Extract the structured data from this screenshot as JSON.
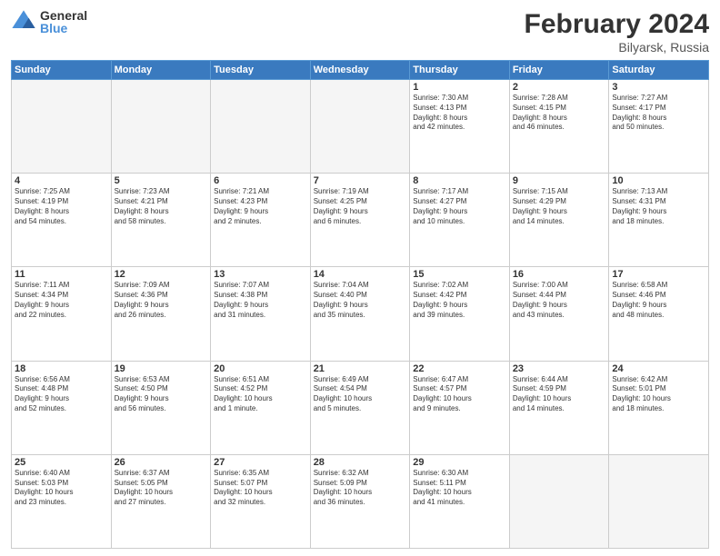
{
  "header": {
    "logo": {
      "general": "General",
      "blue": "Blue"
    },
    "title": "February 2024",
    "location": "Bilyarsk, Russia"
  },
  "calendar": {
    "days_of_week": [
      "Sunday",
      "Monday",
      "Tuesday",
      "Wednesday",
      "Thursday",
      "Friday",
      "Saturday"
    ],
    "weeks": [
      [
        {
          "day": "",
          "info": ""
        },
        {
          "day": "",
          "info": ""
        },
        {
          "day": "",
          "info": ""
        },
        {
          "day": "",
          "info": ""
        },
        {
          "day": "1",
          "info": "Sunrise: 7:30 AM\nSunset: 4:13 PM\nDaylight: 8 hours\nand 42 minutes."
        },
        {
          "day": "2",
          "info": "Sunrise: 7:28 AM\nSunset: 4:15 PM\nDaylight: 8 hours\nand 46 minutes."
        },
        {
          "day": "3",
          "info": "Sunrise: 7:27 AM\nSunset: 4:17 PM\nDaylight: 8 hours\nand 50 minutes."
        }
      ],
      [
        {
          "day": "4",
          "info": "Sunrise: 7:25 AM\nSunset: 4:19 PM\nDaylight: 8 hours\nand 54 minutes."
        },
        {
          "day": "5",
          "info": "Sunrise: 7:23 AM\nSunset: 4:21 PM\nDaylight: 8 hours\nand 58 minutes."
        },
        {
          "day": "6",
          "info": "Sunrise: 7:21 AM\nSunset: 4:23 PM\nDaylight: 9 hours\nand 2 minutes."
        },
        {
          "day": "7",
          "info": "Sunrise: 7:19 AM\nSunset: 4:25 PM\nDaylight: 9 hours\nand 6 minutes."
        },
        {
          "day": "8",
          "info": "Sunrise: 7:17 AM\nSunset: 4:27 PM\nDaylight: 9 hours\nand 10 minutes."
        },
        {
          "day": "9",
          "info": "Sunrise: 7:15 AM\nSunset: 4:29 PM\nDaylight: 9 hours\nand 14 minutes."
        },
        {
          "day": "10",
          "info": "Sunrise: 7:13 AM\nSunset: 4:31 PM\nDaylight: 9 hours\nand 18 minutes."
        }
      ],
      [
        {
          "day": "11",
          "info": "Sunrise: 7:11 AM\nSunset: 4:34 PM\nDaylight: 9 hours\nand 22 minutes."
        },
        {
          "day": "12",
          "info": "Sunrise: 7:09 AM\nSunset: 4:36 PM\nDaylight: 9 hours\nand 26 minutes."
        },
        {
          "day": "13",
          "info": "Sunrise: 7:07 AM\nSunset: 4:38 PM\nDaylight: 9 hours\nand 31 minutes."
        },
        {
          "day": "14",
          "info": "Sunrise: 7:04 AM\nSunset: 4:40 PM\nDaylight: 9 hours\nand 35 minutes."
        },
        {
          "day": "15",
          "info": "Sunrise: 7:02 AM\nSunset: 4:42 PM\nDaylight: 9 hours\nand 39 minutes."
        },
        {
          "day": "16",
          "info": "Sunrise: 7:00 AM\nSunset: 4:44 PM\nDaylight: 9 hours\nand 43 minutes."
        },
        {
          "day": "17",
          "info": "Sunrise: 6:58 AM\nSunset: 4:46 PM\nDaylight: 9 hours\nand 48 minutes."
        }
      ],
      [
        {
          "day": "18",
          "info": "Sunrise: 6:56 AM\nSunset: 4:48 PM\nDaylight: 9 hours\nand 52 minutes."
        },
        {
          "day": "19",
          "info": "Sunrise: 6:53 AM\nSunset: 4:50 PM\nDaylight: 9 hours\nand 56 minutes."
        },
        {
          "day": "20",
          "info": "Sunrise: 6:51 AM\nSunset: 4:52 PM\nDaylight: 10 hours\nand 1 minute."
        },
        {
          "day": "21",
          "info": "Sunrise: 6:49 AM\nSunset: 4:54 PM\nDaylight: 10 hours\nand 5 minutes."
        },
        {
          "day": "22",
          "info": "Sunrise: 6:47 AM\nSunset: 4:57 PM\nDaylight: 10 hours\nand 9 minutes."
        },
        {
          "day": "23",
          "info": "Sunrise: 6:44 AM\nSunset: 4:59 PM\nDaylight: 10 hours\nand 14 minutes."
        },
        {
          "day": "24",
          "info": "Sunrise: 6:42 AM\nSunset: 5:01 PM\nDaylight: 10 hours\nand 18 minutes."
        }
      ],
      [
        {
          "day": "25",
          "info": "Sunrise: 6:40 AM\nSunset: 5:03 PM\nDaylight: 10 hours\nand 23 minutes."
        },
        {
          "day": "26",
          "info": "Sunrise: 6:37 AM\nSunset: 5:05 PM\nDaylight: 10 hours\nand 27 minutes."
        },
        {
          "day": "27",
          "info": "Sunrise: 6:35 AM\nSunset: 5:07 PM\nDaylight: 10 hours\nand 32 minutes."
        },
        {
          "day": "28",
          "info": "Sunrise: 6:32 AM\nSunset: 5:09 PM\nDaylight: 10 hours\nand 36 minutes."
        },
        {
          "day": "29",
          "info": "Sunrise: 6:30 AM\nSunset: 5:11 PM\nDaylight: 10 hours\nand 41 minutes."
        },
        {
          "day": "",
          "info": ""
        },
        {
          "day": "",
          "info": ""
        }
      ]
    ]
  }
}
